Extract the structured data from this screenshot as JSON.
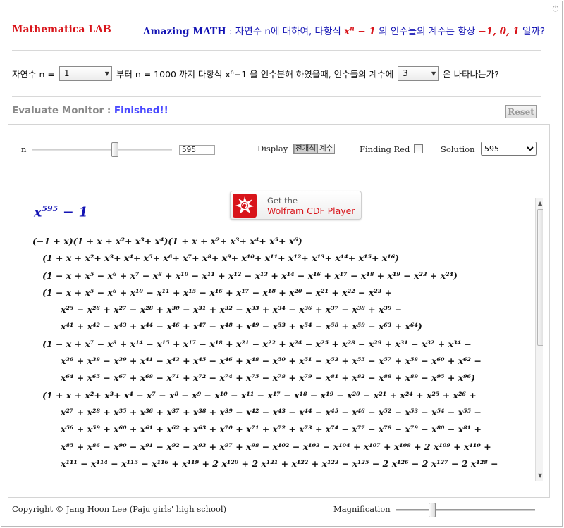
{
  "header": {
    "title": "Mathematica LAB",
    "tagline_brand": "Amazing MATH",
    "tagline_text": " : 자연수 n에 대하여, 다항식 ",
    "tagline_poly": "x",
    "tagline_poly_exp": "n",
    "tagline_poly_tail": " − 1",
    "tagline_mid": " 의 인수들의 계수는 항상 ",
    "tagline_values": "−1, 0, 1",
    "tagline_end": " 일까?"
  },
  "question": {
    "prefix": "자연수 n =",
    "n_value": "1",
    "middle": "부터 n = 1000 까지 다항식 x",
    "sup": "n",
    "middle2": "−1 을 인수분해 하였을때, 인수들의 계수에",
    "coef_value": "3",
    "suffix": "은 나타나는가?"
  },
  "monitor": {
    "label": "Evaluate Monitor : ",
    "status": "Finished!!",
    "reset_label": "Reset"
  },
  "controls": {
    "n_label": "n",
    "n_value": "595",
    "n_slider_fraction": 0.595,
    "display_label": "Display",
    "display_options": [
      "전개식",
      "계수"
    ],
    "display_selected": "전개식",
    "finding_label": "Finding Red",
    "finding_checked": false,
    "solution_label": "Solution",
    "solution_value": "595"
  },
  "output": {
    "title_base": "x",
    "title_exp": "595",
    "title_tail": " − 1",
    "cdf_small": "Get the",
    "cdf_big": "Wolfram CDF Player",
    "factors": [
      "(−1 + x)(1 + x + x²+ x³+ x⁴)(1 + x + x²+ x³+ x⁴+ x⁵+ x⁶)",
      "(1 + x + x²+ x³+ x⁴+ x⁵+ x⁶+ x⁷+ x⁸+ x⁹+ x¹⁰+ x¹¹+ x¹²+ x¹³+ x¹⁴+ x¹⁵+ x¹⁶)",
      "(1 − x + x⁵ − x⁶ + x⁷ − x⁸ + x¹⁰ − x¹¹ + x¹² − x¹³ + x¹⁴ − x¹⁶ + x¹⁷ − x¹⁸ + x¹⁹ − x²³ + x²⁴)",
      "(1 − x + x⁵ − x⁶ + x¹⁰ − x¹¹ + x¹⁵ − x¹⁶ + x¹⁷ − x¹⁸ + x²⁰ − x²¹ + x²² − x²³ +",
      "x²⁵ − x²⁶ + x²⁷ − x²⁸ + x³⁰ − x³¹ + x³² − x³³ + x³⁴ − x³⁶ + x³⁷ − x³⁸ + x³⁹ −",
      "x⁴¹ + x⁴² − x⁴³ + x⁴⁴ − x⁴⁶ + x⁴⁷ − x⁴⁸ + x⁴⁹ − x⁵³ + x⁵⁴ − x⁵⁸ + x⁵⁹ − x⁶³ + x⁶⁴)",
      "(1 − x + x⁷ − x⁸ + x¹⁴ − x¹⁵ + x¹⁷ − x¹⁸ + x²¹ − x²² + x²⁴ − x²⁵ + x²⁸ − x²⁹ + x³¹ − x³² + x³⁴ −",
      "x³⁶ + x³⁸ − x³⁹ + x⁴¹ − x⁴³ + x⁴⁵ − x⁴⁶ + x⁴⁸ − x⁵⁰ + x⁵¹ − x⁵³ + x⁵⁵ − x⁵⁷ + x⁵⁸ − x⁶⁰ + x⁶² −",
      "x⁶⁴ + x⁶⁵ − x⁶⁷ + x⁶⁸ − x⁷¹ + x⁷² − x⁷⁴ + x⁷⁵ − x⁷⁸ + x⁷⁹ − x⁸¹ + x⁸² − x⁸⁸ + x⁸⁹ − x⁹⁵ + x⁹⁶)",
      "(1 + x + x²+ x³+ x⁴ − x⁷ − x⁸ − x⁹ − x¹⁰ − x¹¹ − x¹⁷ − x¹⁸ − x¹⁹ − x²⁰ − x²¹ + x²⁴ + x²⁵ + x²⁶ +",
      "x²⁷ + x²⁸ + x³⁵ + x³⁶ + x³⁷ + x³⁸ + x³⁹ − x⁴² − x⁴³ − x⁴⁴ − x⁴⁵ − x⁴⁶ − x⁵² − x⁵³ − x⁵⁴ − x⁵⁵ −",
      "x⁵⁶ + x⁵⁹ + x⁶⁰ + x⁶¹ + x⁶² + x⁶³ + x⁷⁰ + x⁷¹ + x⁷² + x⁷³ + x⁷⁴ − x⁷⁷ − x⁷⁸ − x⁷⁹ − x⁸⁰ − x⁸¹ +",
      "x⁸⁵ + x⁸⁶ − x⁹⁰ − x⁹¹ − x⁹² − x⁹³ + x⁹⁷ + x⁹⁸ − x¹⁰² − x¹⁰³ − x¹⁰⁴ + x¹⁰⁷ + x¹⁰⁸ + 2 x¹⁰⁹ + x¹¹⁰ +",
      "x¹¹¹ − x¹¹⁴ − x¹¹⁵ − x¹¹⁶ + x¹¹⁹ + 2 x¹²⁰ + 2 x¹²¹ + x¹²² + x¹²³ − x¹²⁵ − 2 x¹²⁶ − 2 x¹²⁷ − 2 x¹²⁸ −"
    ],
    "scroll_fraction": 0.0
  },
  "footer": {
    "copyright": "Copyright © Jang Hoon Lee (Paju girls' high school)",
    "magnification_label": "Magnification",
    "magnification_fraction": 0.25
  },
  "colors": {
    "title_red": "#d8141a",
    "tagline_blue": "#1414b4",
    "status_blue": "#4a4aff",
    "monitor_gray": "#888888"
  },
  "icons": [
    "power-icon",
    "chevron-down-icon",
    "wolfram-spikey-icon",
    "scroll-up-icon",
    "scroll-down-icon"
  ]
}
